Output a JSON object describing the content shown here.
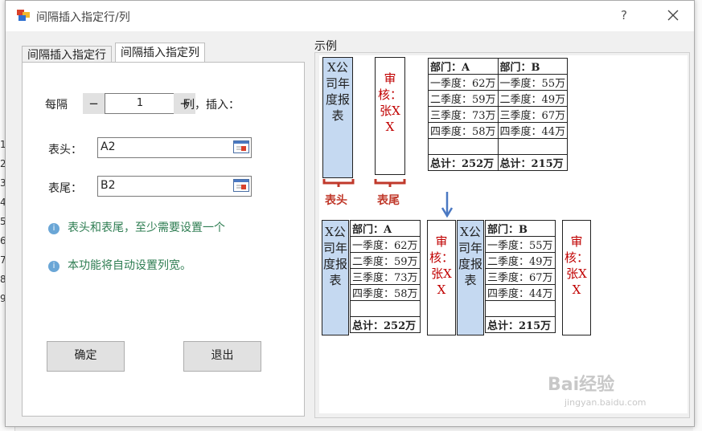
{
  "background": {
    "row_numbers": [
      "1",
      "2",
      "3",
      "4",
      "5",
      "6",
      "7",
      "8",
      "9"
    ]
  },
  "window": {
    "title": "间隔插入指定行/列",
    "help_glyph": "?",
    "app_icon": "excel-tool-icon"
  },
  "tabs": [
    "间隔插入指定行",
    "间隔插入指定列"
  ],
  "form": {
    "every_label": "每隔",
    "minus": "−",
    "interval_value": "1",
    "plus": "+",
    "suffix_label": "列，插入：",
    "header_label": "表头：",
    "header_value": "A2",
    "footer_label": "表尾：",
    "footer_value": "B2",
    "info1": "表头和表尾，至少需要设置一个",
    "info2": "本功能将自动设置列宽。",
    "info_icon": "i",
    "ok": "确定",
    "exit": "退出"
  },
  "example": {
    "group_label": "示例",
    "header_box": "X公司年度报表",
    "footer_box": "审核：张XX",
    "header_caption": "表头",
    "footer_caption": "表尾",
    "dept_a": "部门：A",
    "dept_b": "部门：B",
    "rows_a": [
      "一季度：62万",
      "二季度：59万",
      "三季度：73万",
      "四季度：58万"
    ],
    "rows_b": [
      "一季度：55万",
      "二季度：49万",
      "三季度：67万",
      "四季度：44万"
    ],
    "total_a": "总计：252万",
    "total_b": "总计：215万"
  },
  "watermark": {
    "brand": "Bai经验",
    "url": "jingyan.baidu.com"
  },
  "colors": {
    "accent_blue": "#c5d9f1",
    "red_text": "#c00000",
    "info_green": "#2e7d52"
  }
}
